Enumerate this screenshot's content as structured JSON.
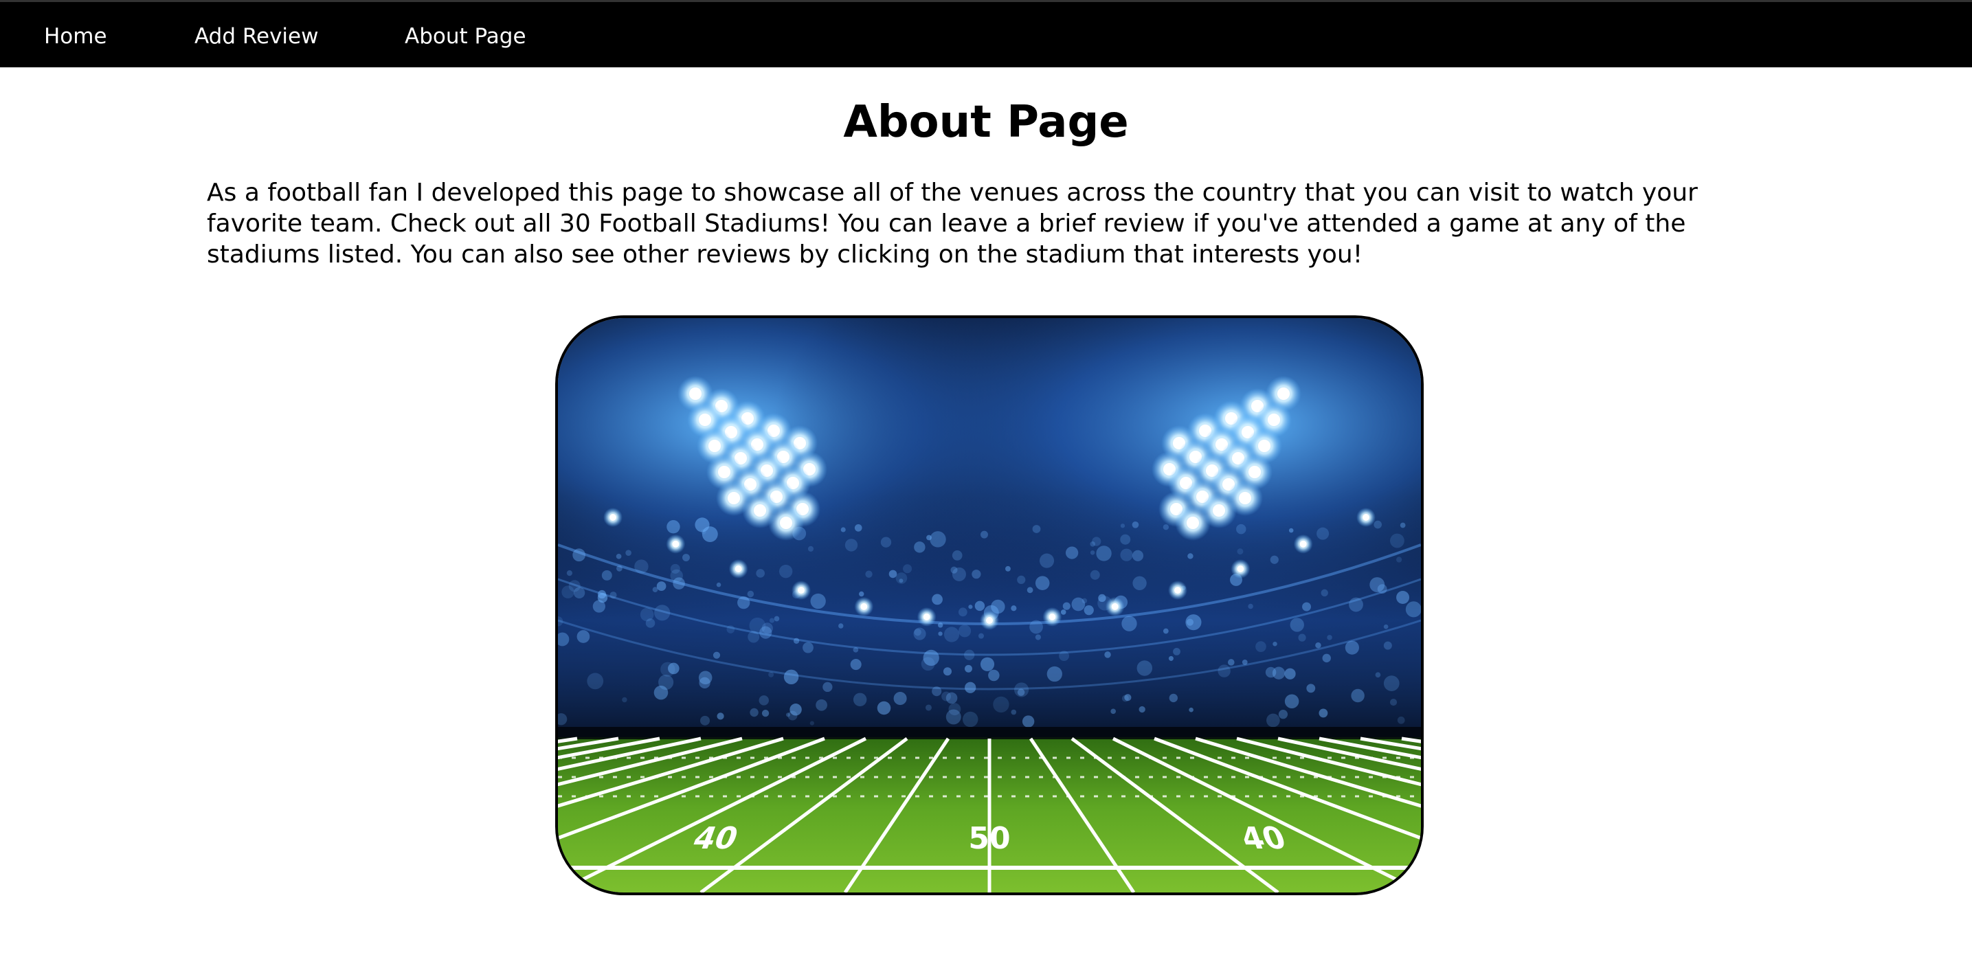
{
  "nav": {
    "items": [
      {
        "label": "Home"
      },
      {
        "label": "Add Review"
      },
      {
        "label": "About Page"
      }
    ]
  },
  "page": {
    "title": "About Page",
    "intro": "As a football fan I developed this page to showcase all of the venues across the country that you can visit to watch your favorite team. Check out all 30 Football Stadiums! You can leave a brief review if you've attended a game at any of the stadiums listed. You can also see other reviews by clicking on the stadium that interests you!"
  },
  "hero_image": {
    "subject": "football stadium at night with floodlights and a green field",
    "colors": {
      "sky": "#050a1a",
      "glow": "#2a6fd6",
      "light": "#cdeeff",
      "field_dark": "#3f8a1c",
      "field_light": "#7cbf2e",
      "lines": "#ffffff"
    },
    "field_numbers": [
      "40",
      "50",
      "40"
    ]
  }
}
